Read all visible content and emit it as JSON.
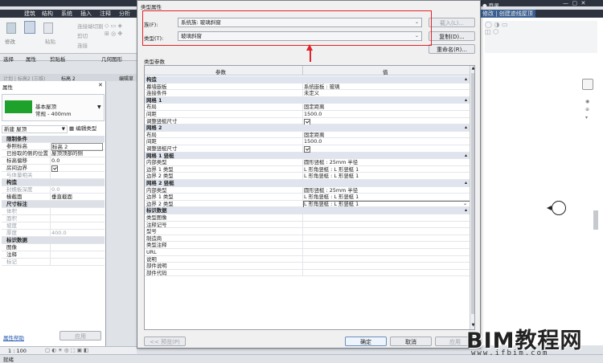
{
  "ribbon": {
    "tabs": [
      "建筑",
      "结构",
      "系统",
      "插入",
      "注释",
      "分析"
    ],
    "items": [
      "修改",
      "粘贴",
      "连接端切割",
      "剪切",
      "连接",
      "选择",
      "属性",
      "剪贴板",
      "几何图形"
    ],
    "right_tab": "修改 | 创建迹线屋顶",
    "user": "登录"
  },
  "view_tabs": [
    "计划 | 标高2 (三维)",
    "标高 2",
    "编辑草"
  ],
  "properties": {
    "title": "属性",
    "type_name": "基本屋顶",
    "type_sub": "常规 - 400mm",
    "instance_selector": "新建 屋顶",
    "edit_type": "编辑类型",
    "rows": [
      {
        "k": "限制条件",
        "v": "",
        "cat": true
      },
      {
        "k": "参照标高",
        "v": "标高 2"
      },
      {
        "k": "已拾取的侧的位置",
        "v": "屋顶顶部的侧"
      },
      {
        "k": "标高偏移",
        "v": "0.0"
      },
      {
        "k": "房间边界",
        "v": "check"
      },
      {
        "k": "与体量相关",
        "v": "",
        "dis": true
      },
      {
        "k": "构造",
        "v": "",
        "cat": true
      },
      {
        "k": "封檐板深度",
        "v": "0.0",
        "dis": true
      },
      {
        "k": "椽截面",
        "v": "垂直截面"
      },
      {
        "k": "尺寸标注",
        "v": "",
        "cat": true
      },
      {
        "k": "体积",
        "v": "",
        "dis": true
      },
      {
        "k": "面积",
        "v": "",
        "dis": true
      },
      {
        "k": "坡度",
        "v": "",
        "dis": true
      },
      {
        "k": "厚度",
        "v": "400.0",
        "dis": true
      },
      {
        "k": "标识数据",
        "v": "",
        "cat": true
      },
      {
        "k": "图像",
        "v": ""
      },
      {
        "k": "注释",
        "v": ""
      },
      {
        "k": "标记",
        "v": "",
        "dis": true
      }
    ],
    "help": "属性帮助",
    "apply": "应用"
  },
  "statusbar": {
    "scale": "1 : 100",
    "left_text": "就绪"
  },
  "dialog": {
    "title": "类型属性",
    "family_label": "族(F):",
    "family_value": "系统族: 玻璃斜窗",
    "type_label": "类型(T):",
    "type_value": "玻璃斜窗",
    "load_button": "载入(L)...",
    "duplicate_button": "复制(D)...",
    "rename_button": "重命名(R)...",
    "type_params_label": "类型参数",
    "col_param": "参数",
    "col_value": "值",
    "groups": [
      {
        "name": "构造",
        "rows": [
          [
            "幕墙嵌板",
            "系统嵌板 : 玻璃"
          ],
          [
            "连接条件",
            "未定义"
          ]
        ]
      },
      {
        "name": "网格 1",
        "rows": [
          [
            "布局",
            "固定距离"
          ],
          [
            "间距",
            "1500.0"
          ],
          [
            "调整竖梃尺寸",
            "check"
          ]
        ]
      },
      {
        "name": "网格 2",
        "rows": [
          [
            "布局",
            "固定距离"
          ],
          [
            "间距",
            "1500.0"
          ],
          [
            "调整竖梃尺寸",
            "check"
          ]
        ]
      },
      {
        "name": "网格 1 竖梃",
        "rows": [
          [
            "内部类型",
            "圆形竖梃 : 25mm 半径"
          ],
          [
            "边界 1 类型",
            "L 形角竖梃 : L 形竖梃 1"
          ],
          [
            "边界 2 类型",
            "L 形角竖梃 : L 形竖梃 1"
          ]
        ]
      },
      {
        "name": "网格 2 竖梃",
        "rows": [
          [
            "内部类型",
            "圆形竖梃 : 25mm 半径"
          ],
          [
            "边界 1 类型",
            "L 形角竖梃 : L 形竖梃 1"
          ],
          [
            "边界 2 类型",
            "L 形角竖梃 : L 形竖梃 1"
          ]
        ]
      },
      {
        "name": "标识数据",
        "rows": [
          [
            "类型图像",
            ""
          ],
          [
            "注释记号",
            ""
          ],
          [
            "型号",
            ""
          ],
          [
            "制造商",
            ""
          ],
          [
            "类型注释",
            ""
          ],
          [
            "URL",
            ""
          ],
          [
            "说明",
            ""
          ],
          [
            "部件说明",
            ""
          ],
          [
            "部件代码",
            ""
          ]
        ]
      }
    ],
    "preview_button": "<< 预览(P)",
    "ok_button": "确定",
    "cancel_button": "取消",
    "apply_button": "应用"
  },
  "watermark": {
    "text": "BIM教程网",
    "url": "www.ifbim.com"
  },
  "colors": {
    "highlight": "#e0242a",
    "swatch": "#1fa22b",
    "dark": "#2d3440"
  }
}
